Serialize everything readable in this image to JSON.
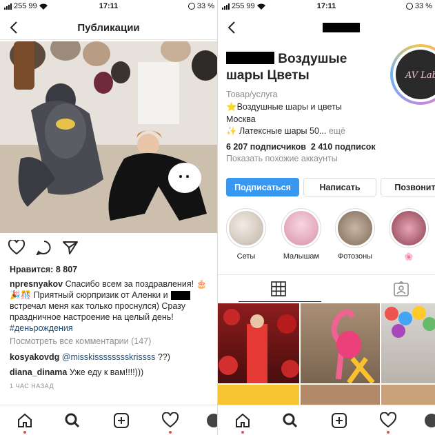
{
  "left": {
    "status": {
      "carrier": "255 99",
      "time": "17:11",
      "battery": "33 %"
    },
    "nav": {
      "title": "Публикации"
    },
    "post": {
      "likes": "Нравится: 8 807",
      "caption_user": "npresnyakov",
      "caption_line1": "Спасибо всем за поздравления! 🎂",
      "caption_line2": "🎉🎊 Приятный сюрпризик от Аленки и",
      "caption_line3": "встречал меня как только проснулся) Сразу",
      "caption_line4": "праздничное настроение на целый день!",
      "hashtag": "#деньрождения",
      "view_all": "Посмотреть все комментарии (147)",
      "comments": [
        {
          "user": "kosyakovdg",
          "mention": "@misskisssssssskrissss",
          "text": " ??)"
        },
        {
          "user": "diana_dinama",
          "mention": "",
          "text": " Уже еду к вам!!!!)))"
        }
      ],
      "time_ago": "1 ЧАС НАЗАД"
    },
    "tabbar": [
      "home-icon",
      "search-icon",
      "add-icon",
      "heart-icon",
      "profile-icon"
    ]
  },
  "right": {
    "status": {
      "carrier": "255 99",
      "time": "17:11",
      "battery": "33 %"
    },
    "profile": {
      "name_line1": "Воздушые",
      "name_line2": "шары Цветы",
      "avatar_text": "AV Lab",
      "category": "Товар/услуга",
      "bio_line1": "⭐Воздушные шары и цветы",
      "bio_line2": "Москва",
      "bio_line3": "✨ Латексные шары  50...",
      "bio_more": " ещё",
      "followers": "6 207 подписчиков",
      "following": "2 410 подписок",
      "similar": "Показать похожие аккаунты"
    },
    "buttons": {
      "follow": "Подписаться",
      "message": "Написать",
      "call": "Позвонит"
    },
    "highlights": [
      {
        "label": "Сеты",
        "color": "#d9cfc4"
      },
      {
        "label": "Малышам",
        "color": "#e9b8c9"
      },
      {
        "label": "Фотозоны",
        "color": "#b8a08c"
      },
      {
        "label": "🌸",
        "color": "#c77a88"
      }
    ],
    "grid_tabs": [
      "grid-icon",
      "tagged-icon"
    ]
  }
}
